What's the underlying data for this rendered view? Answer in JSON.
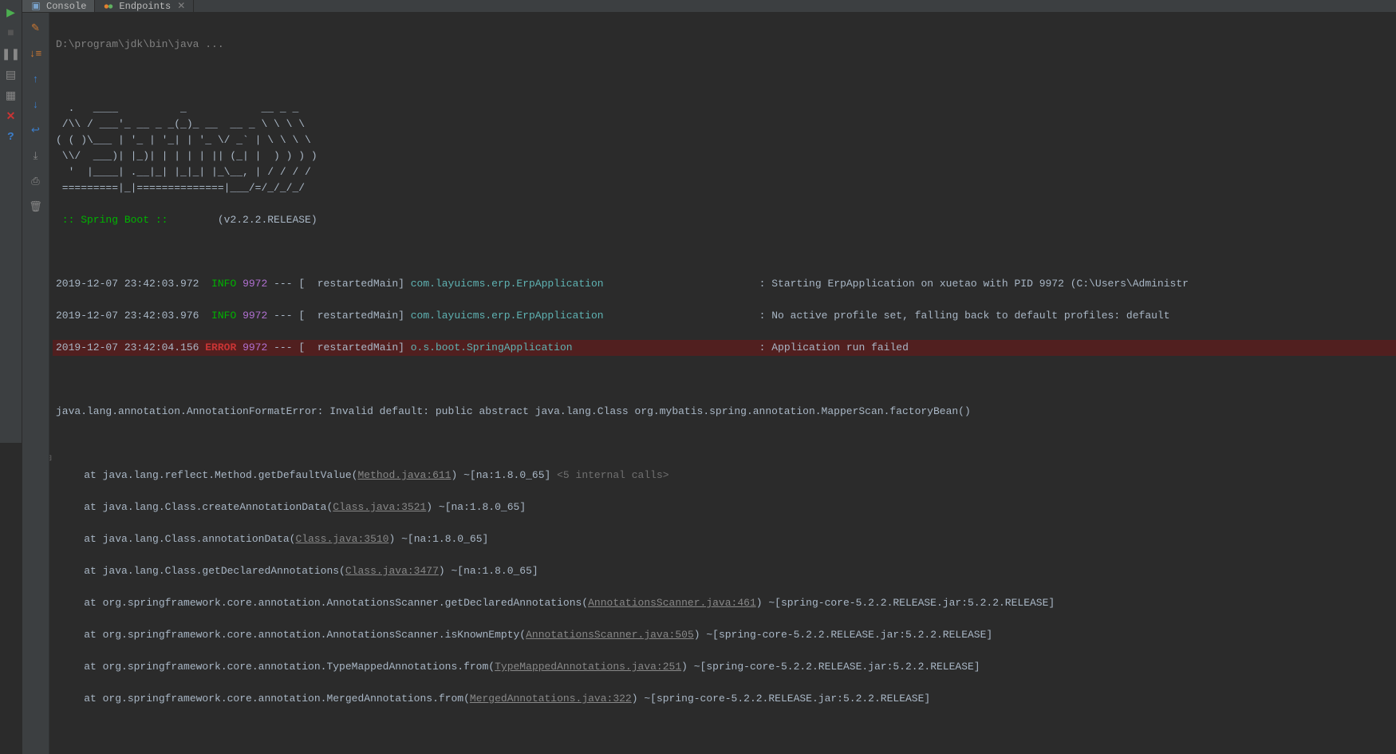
{
  "tabs": {
    "console": "Console",
    "endpoints": "Endpoints"
  },
  "command": "D:\\program\\jdk\\bin\\java ...",
  "banner": "  .   ____          _            __ _ _\n /\\\\ / ___'_ __ _ _(_)_ __  __ _ \\ \\ \\ \\\n( ( )\\___ | '_ | '_| | '_ \\/ _` | \\ \\ \\ \\\n \\\\/  ___)| |_)| | | | | || (_| |  ) ) ) )\n  '  |____| .__|_| |_|_| |_\\__, | / / / /\n =========|_|==============|___/=/_/_/_/",
  "boot": {
    "label": " :: Spring Boot :: ",
    "version": "(v2.2.2.RELEASE)"
  },
  "log": [
    {
      "ts": "2019-12-07 23:42:03.972",
      "lvl": "INFO",
      "pid": "9972",
      "thread": "restartedMain",
      "logger": "com.layuicms.erp.ErpApplication",
      "msg": "Starting ErpApplication on xuetao with PID 9972 (C:\\Users\\Administr"
    },
    {
      "ts": "2019-12-07 23:42:03.976",
      "lvl": "INFO",
      "pid": "9972",
      "thread": "restartedMain",
      "logger": "com.layuicms.erp.ErpApplication",
      "msg": "No active profile set, falling back to default profiles: default"
    },
    {
      "ts": "2019-12-07 23:42:04.156",
      "lvl": "ERROR",
      "pid": "9972",
      "thread": "restartedMain",
      "logger": "o.s.boot.SpringApplication",
      "msg": "Application run failed"
    }
  ],
  "exception": "java.lang.annotation.AnnotationFormatError: Invalid default: public abstract java.lang.Class org.mybatis.spring.annotation.MapperScan.factoryBean()",
  "internal_calls": "<5 internal calls>",
  "stack": [
    {
      "pre": "    at java.lang.reflect.Method.getDefaultValue(",
      "link": "Method.java:611",
      "post": ") ~[na:1.8.0_65] "
    },
    {
      "pre": "    at java.lang.Class.createAnnotationData(",
      "link": "Class.java:3521",
      "post": ") ~[na:1.8.0_65]"
    },
    {
      "pre": "    at java.lang.Class.annotationData(",
      "link": "Class.java:3510",
      "post": ") ~[na:1.8.0_65]"
    },
    {
      "pre": "    at java.lang.Class.getDeclaredAnnotations(",
      "link": "Class.java:3477",
      "post": ") ~[na:1.8.0_65]"
    },
    {
      "pre": "    at org.springframework.core.annotation.AnnotationsScanner.getDeclaredAnnotations(",
      "link": "AnnotationsScanner.java:461",
      "post": ") ~[spring-core-5.2.2.RELEASE.jar:5.2.2.RELEASE]"
    },
    {
      "pre": "    at org.springframework.core.annotation.AnnotationsScanner.isKnownEmpty(",
      "link": "AnnotationsScanner.java:505",
      "post": ") ~[spring-core-5.2.2.RELEASE.jar:5.2.2.RELEASE]"
    },
    {
      "pre": "    at org.springframework.core.annotation.TypeMappedAnnotations.from(",
      "link": "TypeMappedAnnotations.java:251",
      "post": ") ~[spring-core-5.2.2.RELEASE.jar:5.2.2.RELEASE]"
    },
    {
      "pre": "    at org.springframework.core.annotation.MergedAnnotations.from(",
      "link": "MergedAnnotations.java:322",
      "post": ") ~[spring-core-5.2.2.RELEASE.jar:5.2.2.RELEASE]"
    }
  ]
}
